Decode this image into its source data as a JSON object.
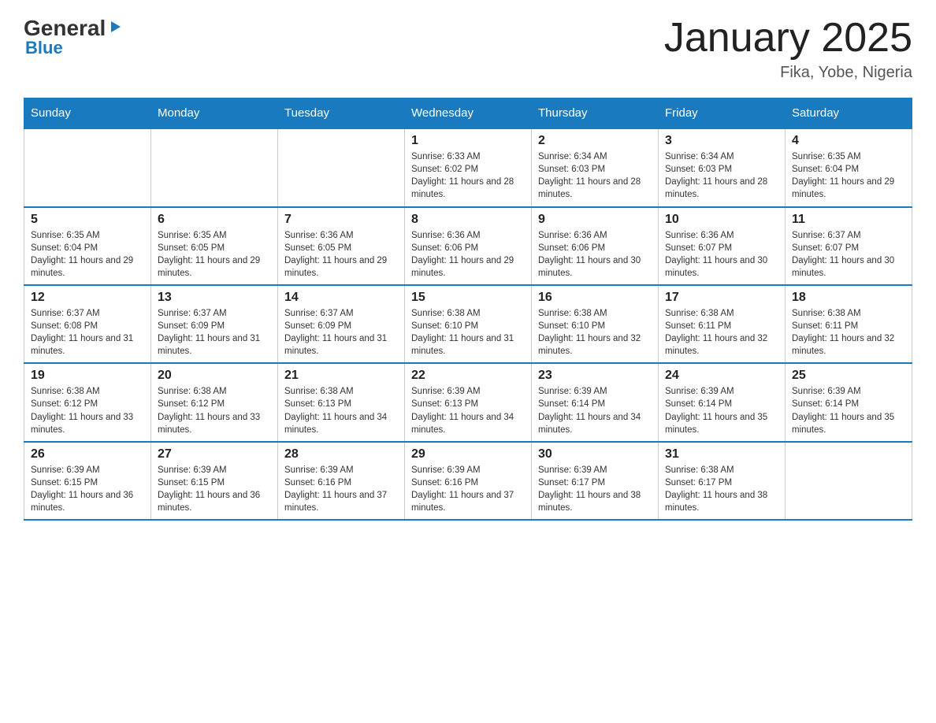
{
  "header": {
    "logo_general": "General",
    "logo_blue": "Blue",
    "title": "January 2025",
    "location": "Fika, Yobe, Nigeria"
  },
  "weekdays": [
    "Sunday",
    "Monday",
    "Tuesday",
    "Wednesday",
    "Thursday",
    "Friday",
    "Saturday"
  ],
  "weeks": [
    [
      {
        "day": "",
        "info": ""
      },
      {
        "day": "",
        "info": ""
      },
      {
        "day": "",
        "info": ""
      },
      {
        "day": "1",
        "info": "Sunrise: 6:33 AM\nSunset: 6:02 PM\nDaylight: 11 hours and 28 minutes."
      },
      {
        "day": "2",
        "info": "Sunrise: 6:34 AM\nSunset: 6:03 PM\nDaylight: 11 hours and 28 minutes."
      },
      {
        "day": "3",
        "info": "Sunrise: 6:34 AM\nSunset: 6:03 PM\nDaylight: 11 hours and 28 minutes."
      },
      {
        "day": "4",
        "info": "Sunrise: 6:35 AM\nSunset: 6:04 PM\nDaylight: 11 hours and 29 minutes."
      }
    ],
    [
      {
        "day": "5",
        "info": "Sunrise: 6:35 AM\nSunset: 6:04 PM\nDaylight: 11 hours and 29 minutes."
      },
      {
        "day": "6",
        "info": "Sunrise: 6:35 AM\nSunset: 6:05 PM\nDaylight: 11 hours and 29 minutes."
      },
      {
        "day": "7",
        "info": "Sunrise: 6:36 AM\nSunset: 6:05 PM\nDaylight: 11 hours and 29 minutes."
      },
      {
        "day": "8",
        "info": "Sunrise: 6:36 AM\nSunset: 6:06 PM\nDaylight: 11 hours and 29 minutes."
      },
      {
        "day": "9",
        "info": "Sunrise: 6:36 AM\nSunset: 6:06 PM\nDaylight: 11 hours and 30 minutes."
      },
      {
        "day": "10",
        "info": "Sunrise: 6:36 AM\nSunset: 6:07 PM\nDaylight: 11 hours and 30 minutes."
      },
      {
        "day": "11",
        "info": "Sunrise: 6:37 AM\nSunset: 6:07 PM\nDaylight: 11 hours and 30 minutes."
      }
    ],
    [
      {
        "day": "12",
        "info": "Sunrise: 6:37 AM\nSunset: 6:08 PM\nDaylight: 11 hours and 31 minutes."
      },
      {
        "day": "13",
        "info": "Sunrise: 6:37 AM\nSunset: 6:09 PM\nDaylight: 11 hours and 31 minutes."
      },
      {
        "day": "14",
        "info": "Sunrise: 6:37 AM\nSunset: 6:09 PM\nDaylight: 11 hours and 31 minutes."
      },
      {
        "day": "15",
        "info": "Sunrise: 6:38 AM\nSunset: 6:10 PM\nDaylight: 11 hours and 31 minutes."
      },
      {
        "day": "16",
        "info": "Sunrise: 6:38 AM\nSunset: 6:10 PM\nDaylight: 11 hours and 32 minutes."
      },
      {
        "day": "17",
        "info": "Sunrise: 6:38 AM\nSunset: 6:11 PM\nDaylight: 11 hours and 32 minutes."
      },
      {
        "day": "18",
        "info": "Sunrise: 6:38 AM\nSunset: 6:11 PM\nDaylight: 11 hours and 32 minutes."
      }
    ],
    [
      {
        "day": "19",
        "info": "Sunrise: 6:38 AM\nSunset: 6:12 PM\nDaylight: 11 hours and 33 minutes."
      },
      {
        "day": "20",
        "info": "Sunrise: 6:38 AM\nSunset: 6:12 PM\nDaylight: 11 hours and 33 minutes."
      },
      {
        "day": "21",
        "info": "Sunrise: 6:38 AM\nSunset: 6:13 PM\nDaylight: 11 hours and 34 minutes."
      },
      {
        "day": "22",
        "info": "Sunrise: 6:39 AM\nSunset: 6:13 PM\nDaylight: 11 hours and 34 minutes."
      },
      {
        "day": "23",
        "info": "Sunrise: 6:39 AM\nSunset: 6:14 PM\nDaylight: 11 hours and 34 minutes."
      },
      {
        "day": "24",
        "info": "Sunrise: 6:39 AM\nSunset: 6:14 PM\nDaylight: 11 hours and 35 minutes."
      },
      {
        "day": "25",
        "info": "Sunrise: 6:39 AM\nSunset: 6:14 PM\nDaylight: 11 hours and 35 minutes."
      }
    ],
    [
      {
        "day": "26",
        "info": "Sunrise: 6:39 AM\nSunset: 6:15 PM\nDaylight: 11 hours and 36 minutes."
      },
      {
        "day": "27",
        "info": "Sunrise: 6:39 AM\nSunset: 6:15 PM\nDaylight: 11 hours and 36 minutes."
      },
      {
        "day": "28",
        "info": "Sunrise: 6:39 AM\nSunset: 6:16 PM\nDaylight: 11 hours and 37 minutes."
      },
      {
        "day": "29",
        "info": "Sunrise: 6:39 AM\nSunset: 6:16 PM\nDaylight: 11 hours and 37 minutes."
      },
      {
        "day": "30",
        "info": "Sunrise: 6:39 AM\nSunset: 6:17 PM\nDaylight: 11 hours and 38 minutes."
      },
      {
        "day": "31",
        "info": "Sunrise: 6:38 AM\nSunset: 6:17 PM\nDaylight: 11 hours and 38 minutes."
      },
      {
        "day": "",
        "info": ""
      }
    ]
  ]
}
